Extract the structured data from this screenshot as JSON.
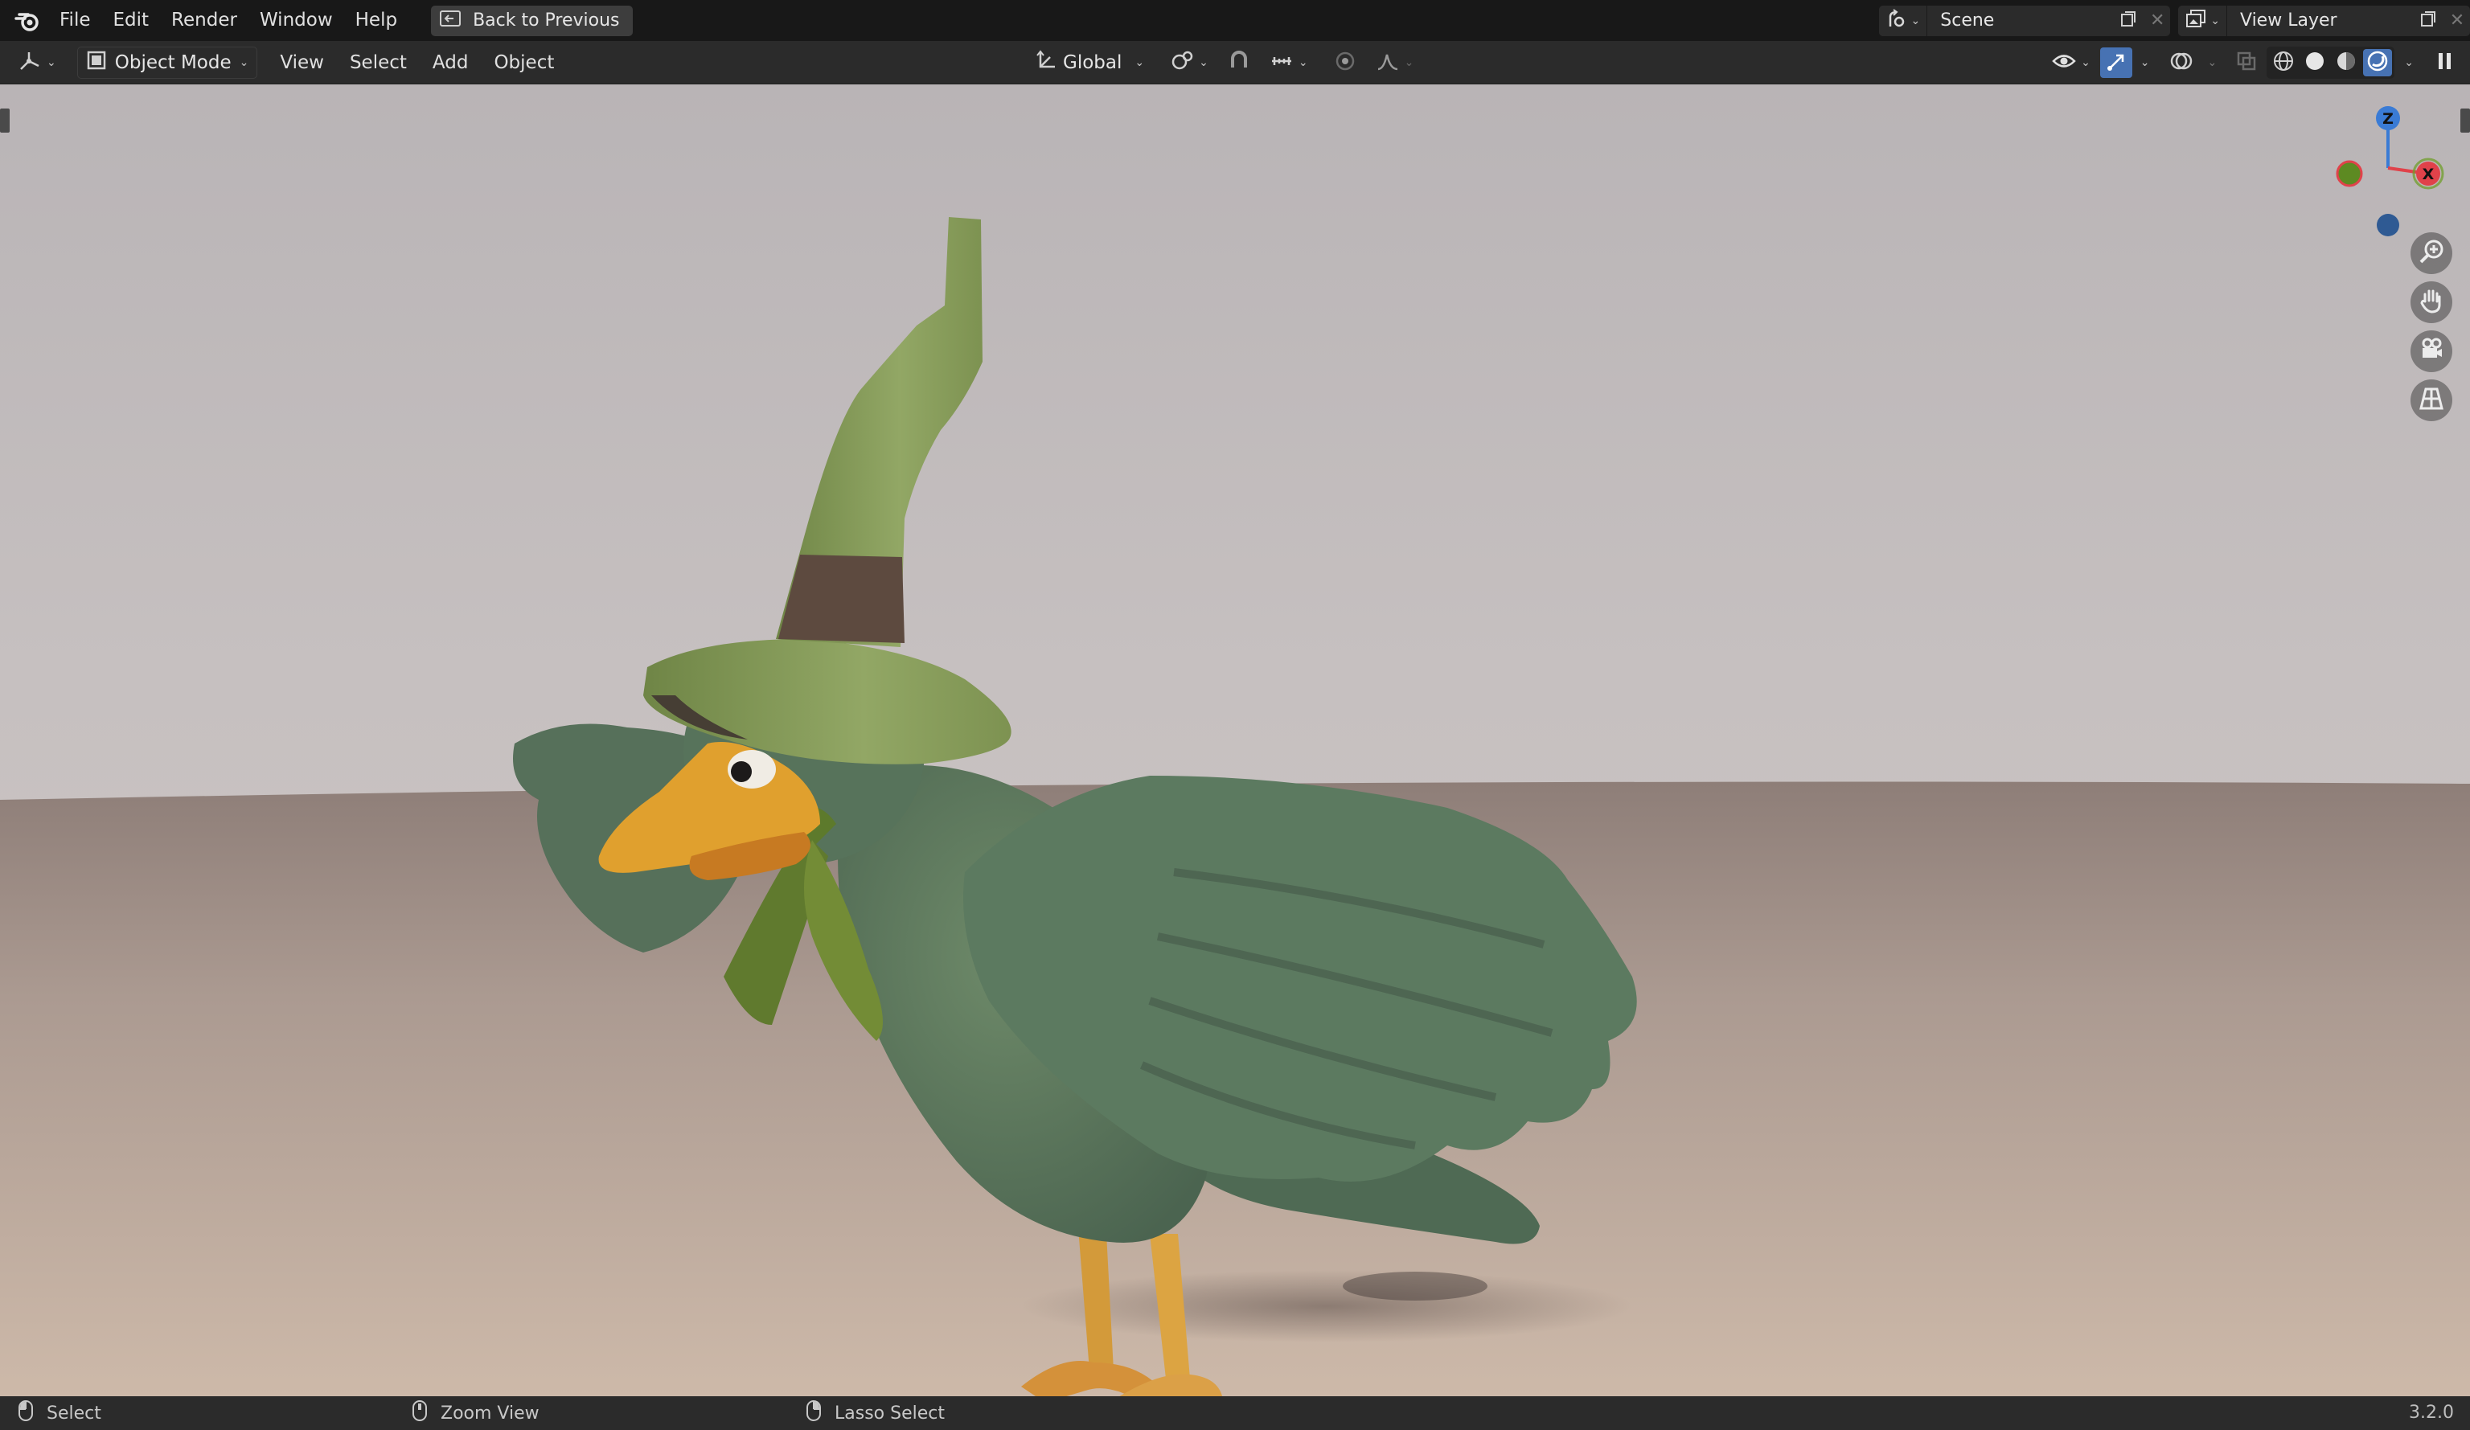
{
  "topbar": {
    "menus": [
      "File",
      "Edit",
      "Render",
      "Window",
      "Help"
    ],
    "back_button": "Back to Previous",
    "scene": "Scene",
    "view_layer": "View Layer"
  },
  "header": {
    "mode": "Object Mode",
    "menus": [
      "View",
      "Select",
      "Add",
      "Object"
    ],
    "orientation": "Global"
  },
  "gizmo": {
    "z_label": "Z",
    "x_label": "X",
    "colors": {
      "x": "#e0424a",
      "y": "#6f9e2a",
      "z": "#3a7bd5"
    }
  },
  "statusbar": {
    "items": [
      "Select",
      "Zoom View",
      "Lasso Select"
    ],
    "version": "3.2.0"
  },
  "colors": {
    "accent": "#4772b3",
    "topbar_bg": "#181818",
    "header_bg": "#2b2b2b"
  }
}
